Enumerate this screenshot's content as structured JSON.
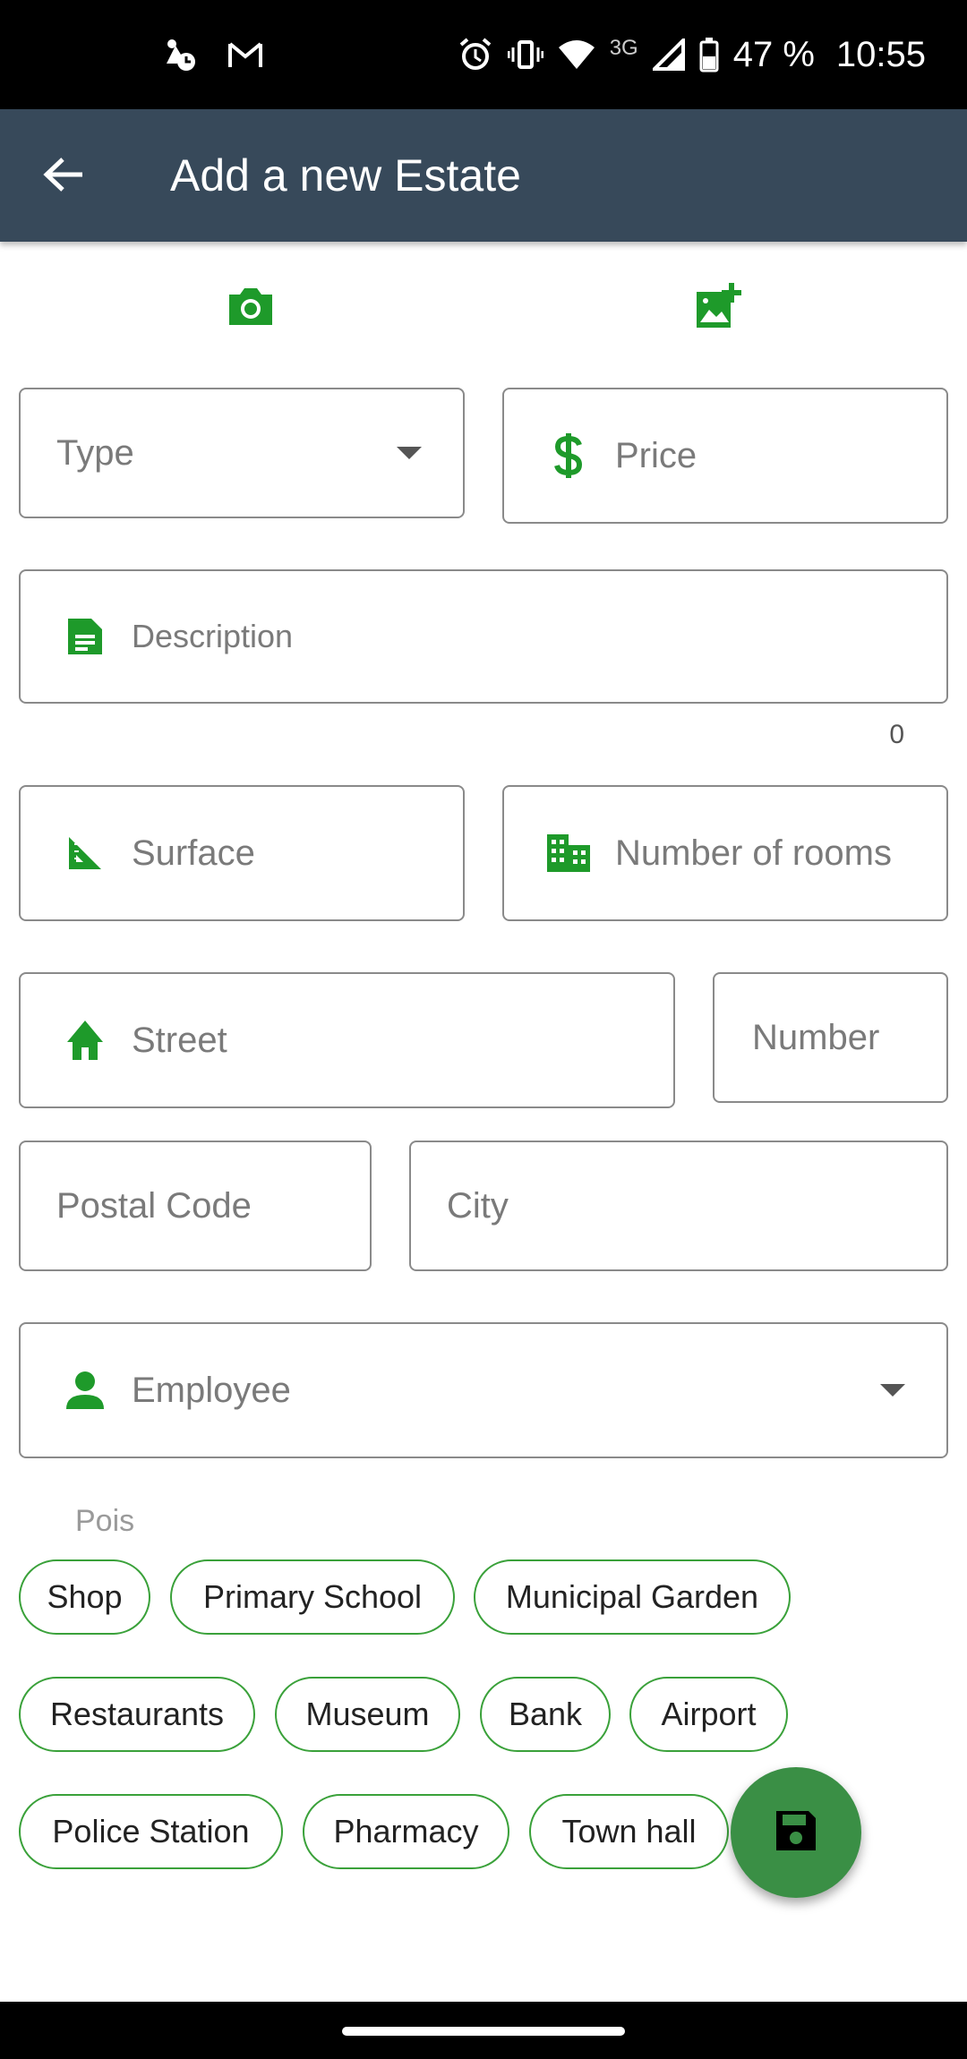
{
  "status_bar": {
    "battery": "47 %",
    "time": "10:55",
    "network": "3G"
  },
  "app_bar": {
    "title": "Add a new Estate"
  },
  "form": {
    "type_placeholder": "Type",
    "price_placeholder": "Price",
    "description_placeholder": "Description",
    "description_counter": "0",
    "surface_placeholder": "Surface",
    "rooms_placeholder": "Number of rooms",
    "street_placeholder": "Street",
    "number_placeholder": "Number",
    "postal_code_placeholder": "Postal Code",
    "city_placeholder": "City",
    "employee_placeholder": "Employee"
  },
  "pois": {
    "label": "Pois",
    "chips": [
      "Shop",
      "Primary School",
      "Municipal Garden",
      "Restaurants",
      "Museum",
      "Bank",
      "Airport",
      "Police Station",
      "Pharmacy",
      "Town hall"
    ]
  },
  "colors": {
    "app_bar": "#37495a",
    "accent_green": "#1e9a2a",
    "chip_border": "#3aa13a",
    "fab": "#3a8f45"
  },
  "icons": {
    "back": "arrow-left-icon",
    "camera": "camera-icon",
    "gallery": "add-photo-icon",
    "price": "dollar-icon",
    "description": "document-icon",
    "surface": "ruler-square-icon",
    "rooms": "building-icon",
    "street": "home-icon",
    "employee": "person-icon",
    "save": "floppy-disk-icon"
  }
}
